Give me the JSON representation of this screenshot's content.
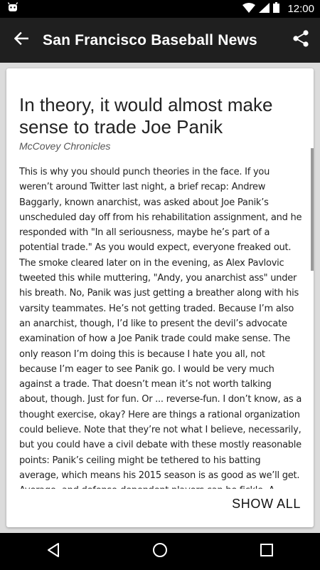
{
  "status_bar": {
    "time": "12:00",
    "icons": [
      "android-icon",
      "wifi-icon",
      "signal-icon",
      "battery-icon"
    ]
  },
  "app_bar": {
    "title": "San Francisco Baseball News",
    "icons": [
      "back-arrow-icon",
      "share-icon"
    ]
  },
  "article": {
    "title": "In theory, it would almost make sense to trade Joe Panik",
    "source": "McCovey Chronicles",
    "body": "This is why you should punch theories in the face. If you weren’t around Twitter last night, a brief recap: Andrew Baggarly, known anarchist, was asked about Joe Panik’s unscheduled day off from his rehabilitation assignment, and he responded with \"In all seriousness, maybe he’s part of a potential trade.\" As you would expect, everyone freaked out. The smoke cleared later on in the evening, as Alex Pavlovic tweeted this while muttering, \"Andy, you anarchist ass\" under his breath. No, Panik was just getting a breather along with his varsity teammates. He’s not getting traded. Because I’m also an anarchist, though, I’d like to present the devil’s advocate examination of how a Joe Panik trade could make sense. The only reason I’m doing this is because I hate you all, not because I’m eager to see Panik go. I would be very much against a trade. That doesn’t mean it’s not worth talking about, though. Just for fun. Or ... reverse-fun. I don’t know, as a thought exercise, okay? Here are things a rational organization could believe. Note that they’re not what I believe, necessarily, but you could have a civil debate with these mostly reasonable points: Panik’s ceiling might be tethered to his batting average, which means his 2015 season is as good as we’ll get. Average- and defense-dependent players can be fickle. A player with 10-homer power would have to field like Ozzie Smith or hit like Ichiro to be truly untouchable. Panik still hasn’t played 100 games in a major league season yet, and his recent maladies might have long-term ramifications. At the very least, they’re warning flags. The Giants’ best prospect also happens to play second base, and it’s possible"
  },
  "show_all_label": "SHOW ALL",
  "nav_bar": {
    "icons": [
      "back-triangle-icon",
      "home-circle-icon",
      "recents-square-icon"
    ]
  },
  "colors": {
    "app_bar": "#1f1f1f",
    "status_bar": "#000000",
    "card": "#ffffff",
    "background": "#dcdcdc"
  }
}
